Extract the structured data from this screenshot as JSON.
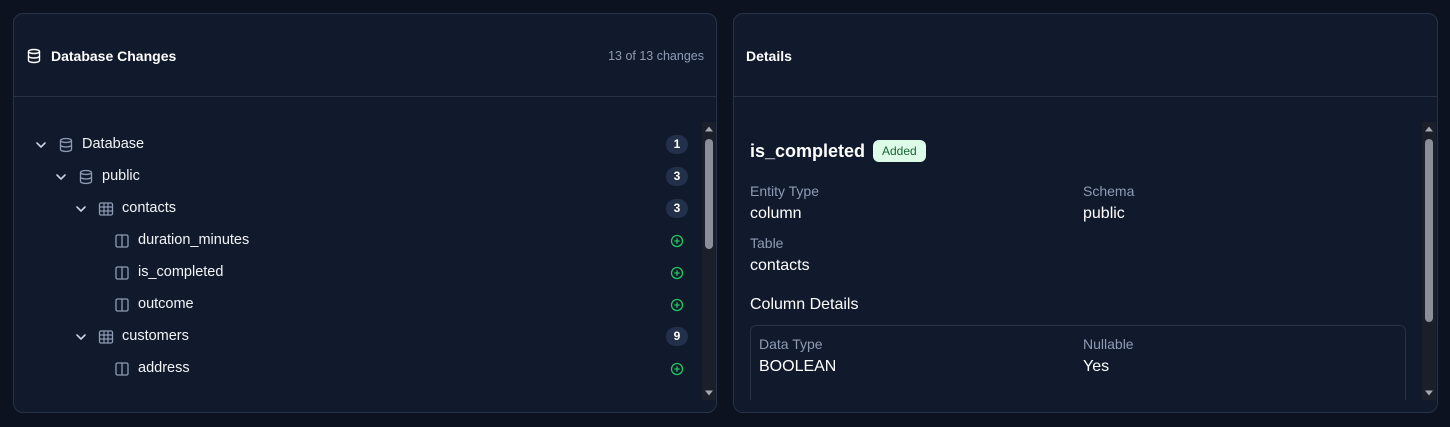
{
  "left_panel": {
    "title": "Database Changes",
    "title_icon": "database-icon",
    "changes_count": "13 of 13 changes",
    "tree": [
      {
        "label": "Database",
        "icon": "database-icon",
        "level": 0,
        "expanded": true,
        "count": "1"
      },
      {
        "label": "public",
        "icon": "database-icon",
        "level": 1,
        "expanded": true,
        "count": "3"
      },
      {
        "label": "contacts",
        "icon": "table-icon",
        "level": 2,
        "expanded": true,
        "count": "3"
      },
      {
        "label": "duration_minutes",
        "icon": "column-icon",
        "level": 3,
        "status": "added"
      },
      {
        "label": "is_completed",
        "icon": "column-icon",
        "level": 3,
        "status": "added"
      },
      {
        "label": "outcome",
        "icon": "column-icon",
        "level": 3,
        "status": "added"
      },
      {
        "label": "customers",
        "icon": "table-icon",
        "level": 2,
        "expanded": true,
        "count": "9"
      },
      {
        "label": "address",
        "icon": "column-icon",
        "level": 3,
        "status": "added"
      }
    ]
  },
  "right_panel": {
    "title": "Details",
    "entity_name": "is_completed",
    "status_badge": "Added",
    "fields": {
      "entity_type_label": "Entity Type",
      "entity_type_value": "column",
      "schema_label": "Schema",
      "schema_value": "public",
      "table_label": "Table",
      "table_value": "contacts"
    },
    "column_details": {
      "title": "Column Details",
      "data_type_label": "Data Type",
      "data_type_value": "BOOLEAN",
      "nullable_label": "Nullable",
      "nullable_value": "Yes"
    }
  },
  "colors": {
    "background": "#0d1221",
    "panel": "#111a2c",
    "border": "#263247",
    "added_green": "#22c55e",
    "badge_bg": "#dcfce7",
    "badge_text": "#166534"
  }
}
